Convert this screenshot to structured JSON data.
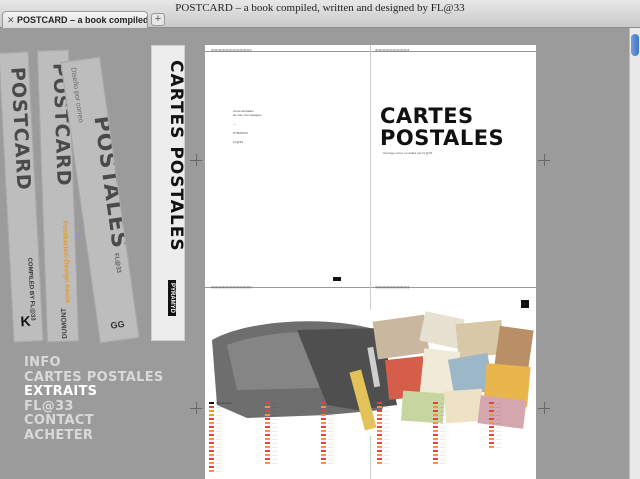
{
  "window": {
    "title": "POSTCARD – a book compiled, written and designed by FL@33",
    "tab_label": "POSTCARD – a book compiled, ...",
    "tab_close": "✕",
    "new_tab": "+"
  },
  "spines": [
    {
      "title": "POSTCARD",
      "subtitle": "COMPILED BY FL@33",
      "publisher": "K"
    },
    {
      "title": "POSTCARD",
      "subtitle": "Postkarten-Design heute",
      "publisher": "DUMONT"
    },
    {
      "title": "POSTALES",
      "subtitle": "Diseño por correo",
      "publisher": "GG",
      "small": "FL@33"
    },
    {
      "title": "CARTES POSTALES",
      "publisher": "PYRAMYD"
    }
  ],
  "nav": {
    "items": [
      {
        "label": "INFO",
        "active": false
      },
      {
        "label": "CARTES POSTALES",
        "active": false
      },
      {
        "label": "EXTRAITS",
        "active": true
      },
      {
        "label": "FL@33",
        "active": false
      },
      {
        "label": "CONTACT",
        "active": false
      },
      {
        "label": "ACHETER",
        "active": false
      }
    ]
  },
  "preview": {
    "title_line1": "CARTES",
    "title_line2": "POSTALES",
    "subtitle": "Ouvrage conçu et réalisé par FL@33",
    "colophon": "Communication\nau nom d'un designer\n\n—\n\nPYRAMYD\n\nFL@33"
  },
  "colors": {
    "accent_orange": "#e89a2c",
    "nav_active": "#ffffff",
    "nav_inactive": "#d9d9d9",
    "scroll_thumb": "#4a7fd0"
  }
}
